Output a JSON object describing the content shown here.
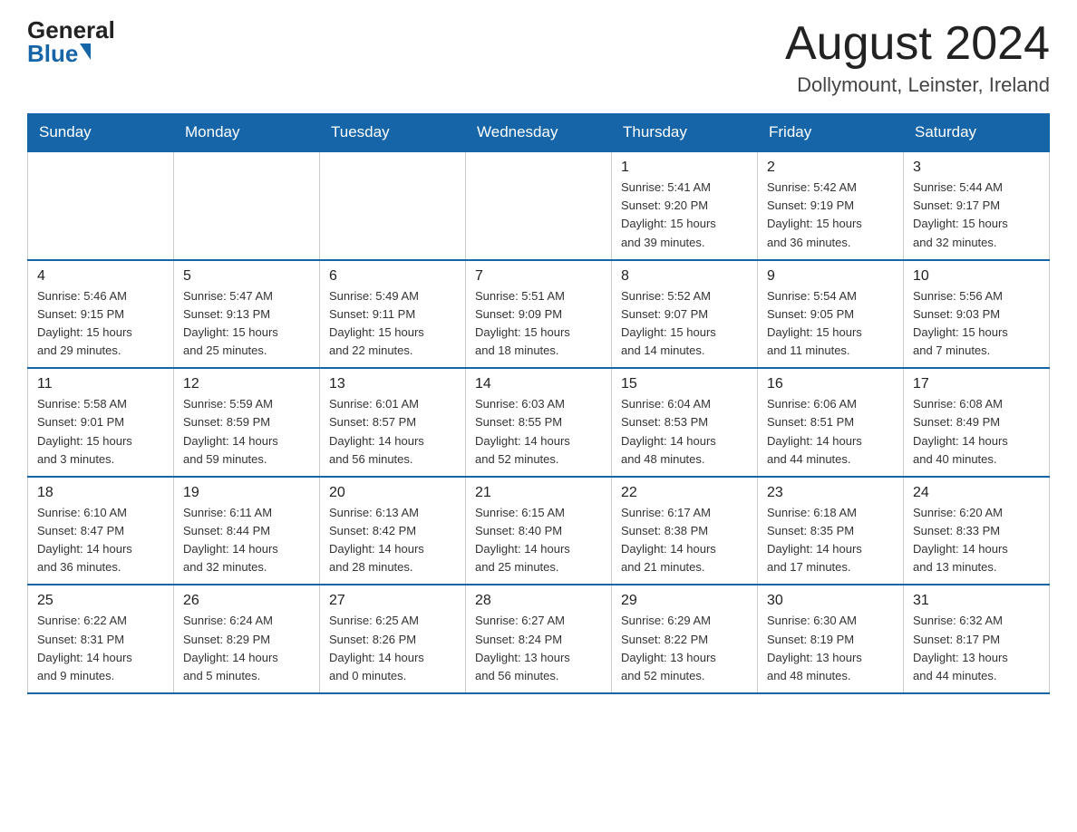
{
  "logo": {
    "general": "General",
    "blue": "Blue"
  },
  "title": "August 2024",
  "location": "Dollymount, Leinster, Ireland",
  "days_of_week": [
    "Sunday",
    "Monday",
    "Tuesday",
    "Wednesday",
    "Thursday",
    "Friday",
    "Saturday"
  ],
  "weeks": [
    [
      {
        "day": "",
        "info": ""
      },
      {
        "day": "",
        "info": ""
      },
      {
        "day": "",
        "info": ""
      },
      {
        "day": "",
        "info": ""
      },
      {
        "day": "1",
        "info": "Sunrise: 5:41 AM\nSunset: 9:20 PM\nDaylight: 15 hours\nand 39 minutes."
      },
      {
        "day": "2",
        "info": "Sunrise: 5:42 AM\nSunset: 9:19 PM\nDaylight: 15 hours\nand 36 minutes."
      },
      {
        "day": "3",
        "info": "Sunrise: 5:44 AM\nSunset: 9:17 PM\nDaylight: 15 hours\nand 32 minutes."
      }
    ],
    [
      {
        "day": "4",
        "info": "Sunrise: 5:46 AM\nSunset: 9:15 PM\nDaylight: 15 hours\nand 29 minutes."
      },
      {
        "day": "5",
        "info": "Sunrise: 5:47 AM\nSunset: 9:13 PM\nDaylight: 15 hours\nand 25 minutes."
      },
      {
        "day": "6",
        "info": "Sunrise: 5:49 AM\nSunset: 9:11 PM\nDaylight: 15 hours\nand 22 minutes."
      },
      {
        "day": "7",
        "info": "Sunrise: 5:51 AM\nSunset: 9:09 PM\nDaylight: 15 hours\nand 18 minutes."
      },
      {
        "day": "8",
        "info": "Sunrise: 5:52 AM\nSunset: 9:07 PM\nDaylight: 15 hours\nand 14 minutes."
      },
      {
        "day": "9",
        "info": "Sunrise: 5:54 AM\nSunset: 9:05 PM\nDaylight: 15 hours\nand 11 minutes."
      },
      {
        "day": "10",
        "info": "Sunrise: 5:56 AM\nSunset: 9:03 PM\nDaylight: 15 hours\nand 7 minutes."
      }
    ],
    [
      {
        "day": "11",
        "info": "Sunrise: 5:58 AM\nSunset: 9:01 PM\nDaylight: 15 hours\nand 3 minutes."
      },
      {
        "day": "12",
        "info": "Sunrise: 5:59 AM\nSunset: 8:59 PM\nDaylight: 14 hours\nand 59 minutes."
      },
      {
        "day": "13",
        "info": "Sunrise: 6:01 AM\nSunset: 8:57 PM\nDaylight: 14 hours\nand 56 minutes."
      },
      {
        "day": "14",
        "info": "Sunrise: 6:03 AM\nSunset: 8:55 PM\nDaylight: 14 hours\nand 52 minutes."
      },
      {
        "day": "15",
        "info": "Sunrise: 6:04 AM\nSunset: 8:53 PM\nDaylight: 14 hours\nand 48 minutes."
      },
      {
        "day": "16",
        "info": "Sunrise: 6:06 AM\nSunset: 8:51 PM\nDaylight: 14 hours\nand 44 minutes."
      },
      {
        "day": "17",
        "info": "Sunrise: 6:08 AM\nSunset: 8:49 PM\nDaylight: 14 hours\nand 40 minutes."
      }
    ],
    [
      {
        "day": "18",
        "info": "Sunrise: 6:10 AM\nSunset: 8:47 PM\nDaylight: 14 hours\nand 36 minutes."
      },
      {
        "day": "19",
        "info": "Sunrise: 6:11 AM\nSunset: 8:44 PM\nDaylight: 14 hours\nand 32 minutes."
      },
      {
        "day": "20",
        "info": "Sunrise: 6:13 AM\nSunset: 8:42 PM\nDaylight: 14 hours\nand 28 minutes."
      },
      {
        "day": "21",
        "info": "Sunrise: 6:15 AM\nSunset: 8:40 PM\nDaylight: 14 hours\nand 25 minutes."
      },
      {
        "day": "22",
        "info": "Sunrise: 6:17 AM\nSunset: 8:38 PM\nDaylight: 14 hours\nand 21 minutes."
      },
      {
        "day": "23",
        "info": "Sunrise: 6:18 AM\nSunset: 8:35 PM\nDaylight: 14 hours\nand 17 minutes."
      },
      {
        "day": "24",
        "info": "Sunrise: 6:20 AM\nSunset: 8:33 PM\nDaylight: 14 hours\nand 13 minutes."
      }
    ],
    [
      {
        "day": "25",
        "info": "Sunrise: 6:22 AM\nSunset: 8:31 PM\nDaylight: 14 hours\nand 9 minutes."
      },
      {
        "day": "26",
        "info": "Sunrise: 6:24 AM\nSunset: 8:29 PM\nDaylight: 14 hours\nand 5 minutes."
      },
      {
        "day": "27",
        "info": "Sunrise: 6:25 AM\nSunset: 8:26 PM\nDaylight: 14 hours\nand 0 minutes."
      },
      {
        "day": "28",
        "info": "Sunrise: 6:27 AM\nSunset: 8:24 PM\nDaylight: 13 hours\nand 56 minutes."
      },
      {
        "day": "29",
        "info": "Sunrise: 6:29 AM\nSunset: 8:22 PM\nDaylight: 13 hours\nand 52 minutes."
      },
      {
        "day": "30",
        "info": "Sunrise: 6:30 AM\nSunset: 8:19 PM\nDaylight: 13 hours\nand 48 minutes."
      },
      {
        "day": "31",
        "info": "Sunrise: 6:32 AM\nSunset: 8:17 PM\nDaylight: 13 hours\nand 44 minutes."
      }
    ]
  ]
}
